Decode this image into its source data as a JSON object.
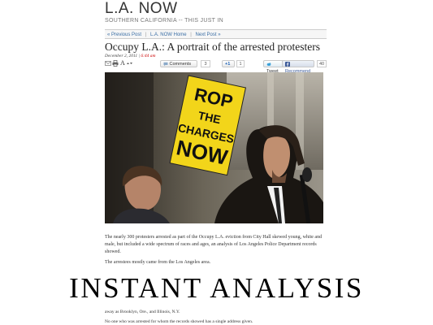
{
  "blog": {
    "title": "L.A. NOW",
    "subtitle": "SOUTHERN CALIFORNIA -- THIS JUST IN"
  },
  "nav": {
    "previous": "« Previous Post",
    "home": "L.A. NOW Home",
    "next": "Next Post »",
    "separator": "|"
  },
  "article": {
    "headline": "Occupy L.A.: A portrait of the arrested protesters",
    "date": "December 2, 2011",
    "date_sep": "|",
    "time": "6:44 am"
  },
  "toolbar": {
    "text_size_label": "A",
    "comments_label": "Comments",
    "comments_count": "3",
    "plusone_label": "+1",
    "plusone_count": "1",
    "tweet_label": "Tweet",
    "tweet_count": "57",
    "recommend_label": "Recommend",
    "recommend_count": "40"
  },
  "photo": {
    "sign_text": "ROP THE CHARGES NOW"
  },
  "paragraphs": {
    "p1": "The nearly 300 protesters arrested as part of the Occupy L.A. eviction from City Hall skewed young, white and male, but included a wide spectrum of races and ages, an analysis of Los Angeles Police Department records showed.",
    "p2": "The arrestees mostly came from the Los Angeles area.",
    "p3": "away as Brooklyn, Ore., and Illinois, N.Y.",
    "p4": "No one who was arrested for whom the records showed has a single address given."
  },
  "overlay": {
    "text": "INSTANT ANALYSIS"
  },
  "colors": {
    "link": "#3a6ea5",
    "time": "#cc0000",
    "sign_yellow": "#f2d51a"
  }
}
